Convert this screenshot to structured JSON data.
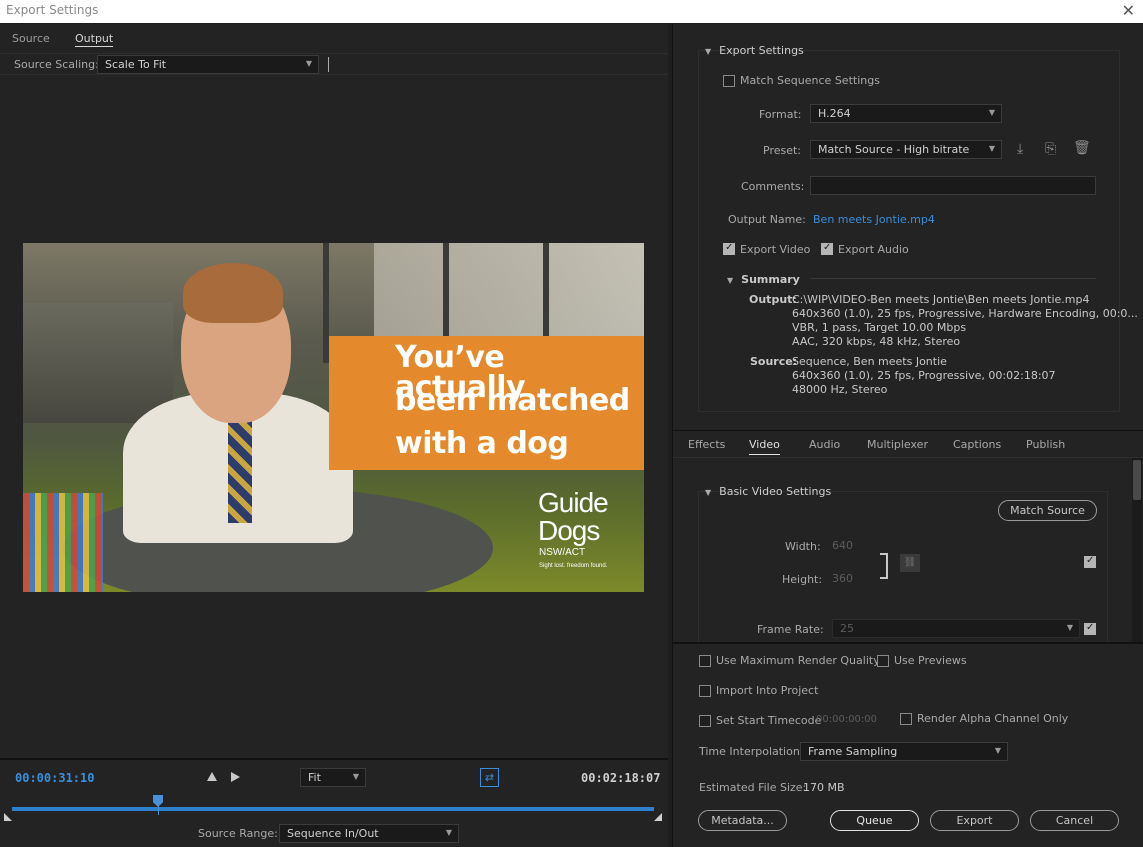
{
  "window": {
    "title": "Export Settings",
    "close": "✕"
  },
  "left": {
    "tabs": [
      "Source",
      "Output"
    ],
    "active_tab": "Output",
    "source_scaling": {
      "label": "Source Scaling:",
      "value": "Scale To Fit"
    },
    "video_overlay": {
      "lines": [
        "You’ve actually",
        "been matched",
        "with a dog"
      ],
      "logo": [
        "Guide",
        "Dogs",
        "NSW/ACT",
        "Sight lost. freedom found."
      ]
    },
    "timeline": {
      "current_timecode": "00:00:31:10",
      "zoom": "Fit",
      "duration_timecode": "00:02:18:07",
      "source_range_label": "Source Range:",
      "source_range_value": "Sequence In/Out"
    }
  },
  "export_settings": {
    "title": "Export Settings",
    "match_sequence": "Match Sequence Settings",
    "format_label": "Format:",
    "format_value": "H.264",
    "preset_label": "Preset:",
    "preset_value": "Match Source - High bitrate",
    "comments_label": "Comments:",
    "output_name_label": "Output Name:",
    "output_name_value": "Ben meets Jontie.mp4",
    "export_video": "Export Video",
    "export_audio": "Export Audio",
    "summary": {
      "title": "Summary",
      "output_label": "Output:",
      "output_lines": [
        "C:\\WIP\\VIDEO-Ben meets Jontie\\Ben meets Jontie.mp4",
        "640x360 (1.0), 25 fps, Progressive, Hardware Encoding, 00:0...",
        "VBR, 1 pass, Target 10.00 Mbps",
        "AAC, 320 kbps, 48 kHz, Stereo"
      ],
      "source_label": "Source:",
      "source_lines": [
        "Sequence, Ben meets Jontie",
        "640x360 (1.0), 25 fps, Progressive, 00:02:18:07",
        "48000 Hz, Stereo"
      ]
    }
  },
  "subtabs": [
    "Effects",
    "Video",
    "Audio",
    "Multiplexer",
    "Captions",
    "Publish"
  ],
  "active_subtab": "Video",
  "basic_video": {
    "title": "Basic Video Settings",
    "match_source": "Match Source",
    "width_label": "Width:",
    "width_value": "640",
    "height_label": "Height:",
    "height_value": "360",
    "frame_rate_label": "Frame Rate:",
    "frame_rate_value": "25"
  },
  "bottom": {
    "max_render": "Use Maximum Render Quality",
    "use_previews": "Use Previews",
    "import_project": "Import Into Project",
    "start_timecode": "Set Start Timecode",
    "start_timecode_value": "00:00:00:00",
    "render_alpha": "Render Alpha Channel Only",
    "time_interp_label": "Time Interpolation:",
    "time_interp_value": "Frame Sampling",
    "file_size_label": "Estimated File Size:",
    "file_size_value": "170 MB",
    "buttons": {
      "metadata": "Metadata...",
      "queue": "Queue",
      "export": "Export",
      "cancel": "Cancel"
    }
  }
}
